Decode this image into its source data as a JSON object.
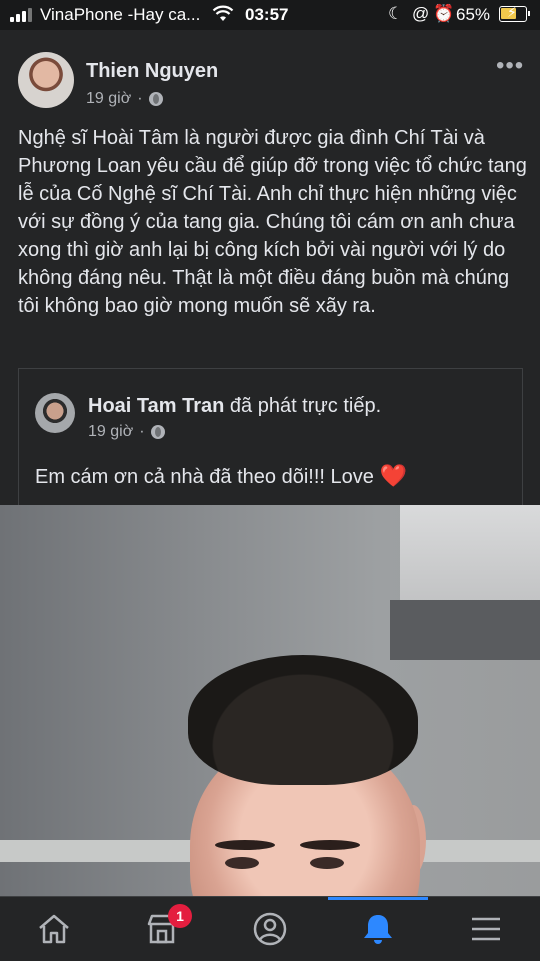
{
  "status_bar": {
    "carrier": "VinaPhone -Hay ca...",
    "time": "03:57",
    "battery_percent": "65%",
    "battery_level": 0.65,
    "icons": [
      "signal-icon",
      "wifi-icon",
      "moon-icon",
      "at-icon",
      "alarm-icon",
      "battery-charging-icon"
    ]
  },
  "post": {
    "author": "Thien Nguyen",
    "time": "19 giờ",
    "separator": "·",
    "more_label": "•••",
    "text": "Nghệ sĩ Hoài Tâm là người được gia đình Chí Tài và Phương Loan yêu cầu để giúp đỡ trong việc tổ chức tang lễ của Cố Nghệ sĩ Chí Tài. Anh chỉ thực hiện những việc với sự đồng ý của tang gia. Chúng tôi cám ơn anh chưa xong thì giờ anh lại bị công kích bởi vài người với lý do không đáng nêu. Thật là một điều đáng buồn mà chúng tôi không bao giờ mong muốn sẽ xãy ra."
  },
  "shared_post": {
    "author": "Hoai Tam Tran",
    "action": "đã phát trực tiếp.",
    "time": "19 giờ",
    "separator": "·",
    "text": "Em cám ơn cả nhà đã theo dõi!!! Love",
    "emoji": "❤️"
  },
  "bottom_nav": {
    "items": [
      "home-icon",
      "marketplace-icon",
      "profile-icon",
      "notifications-icon",
      "menu-icon"
    ],
    "active": "notifications-icon",
    "marketplace_badge": "1"
  },
  "colors": {
    "background": "#18191a",
    "card": "#242526",
    "text": "#e4e6eb",
    "muted": "#b0b3b8",
    "accent": "#2d88ff",
    "badge": "#e41e3f"
  }
}
